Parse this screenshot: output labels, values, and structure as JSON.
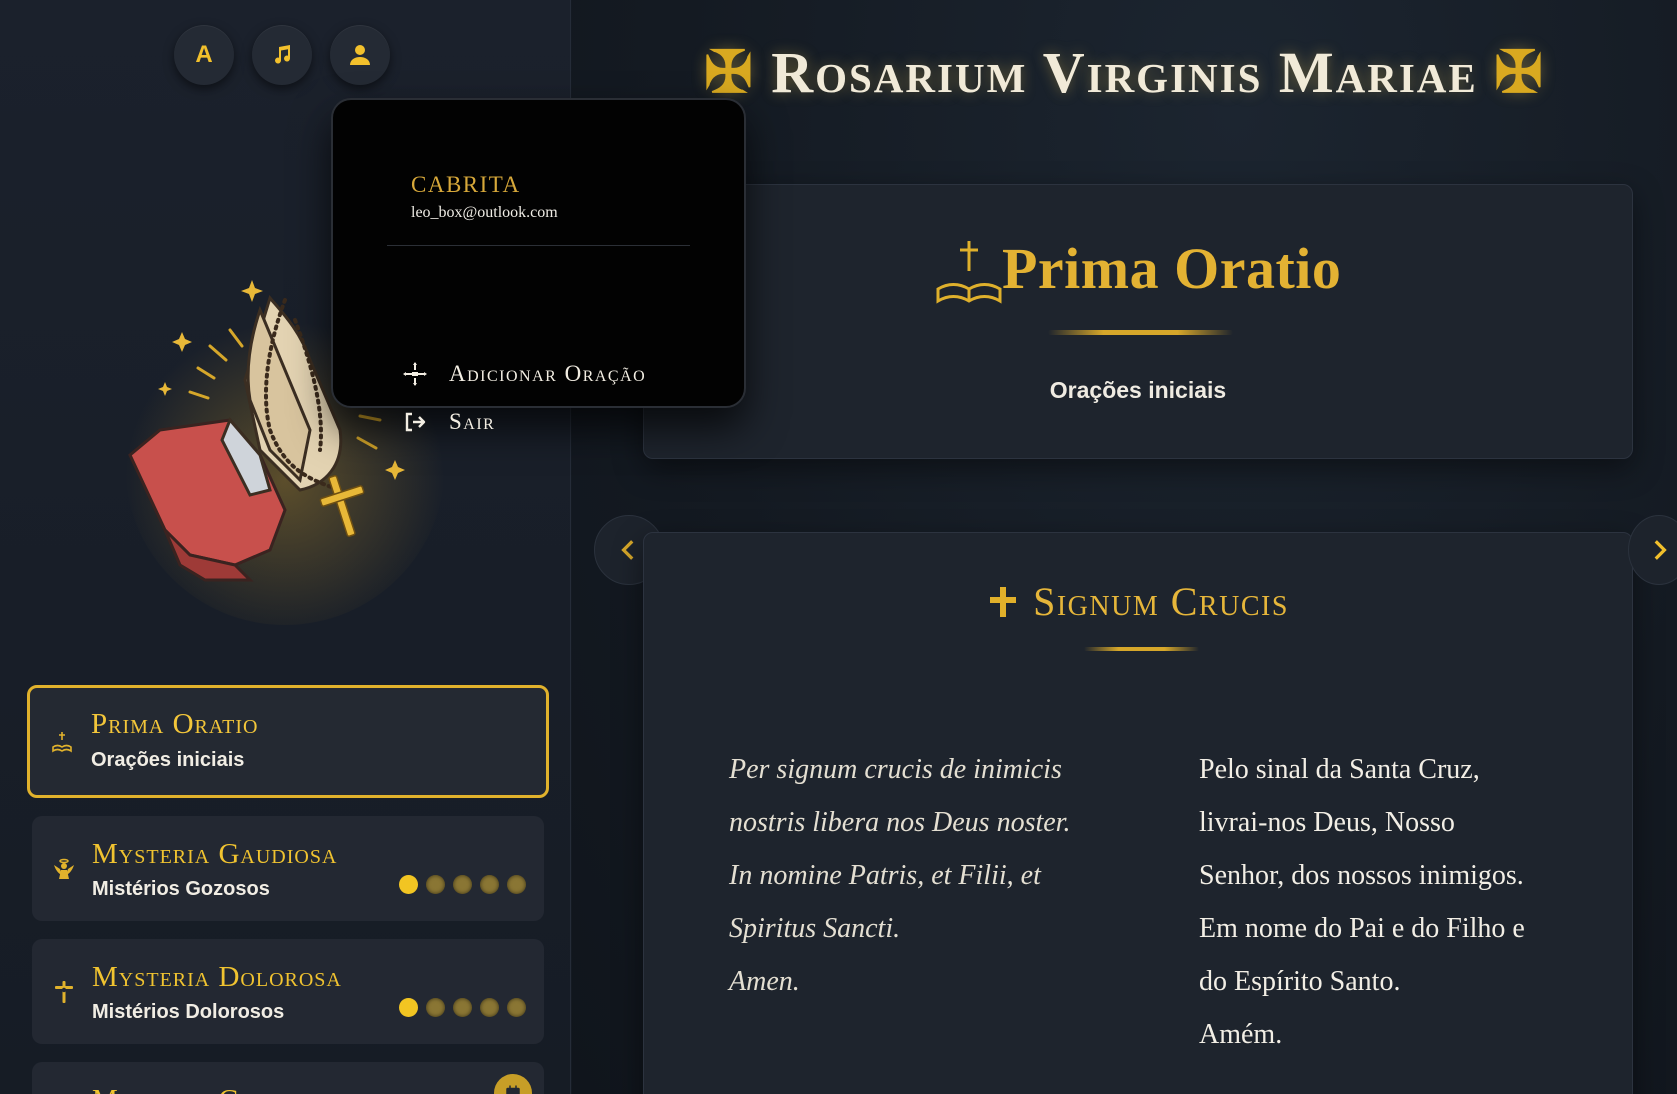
{
  "toolbar": {
    "font_btn": "A"
  },
  "user_menu": {
    "name": "CABRITA",
    "email": "leo_box@outlook.com",
    "items": [
      {
        "label": "Adicionar Oração",
        "icon": "cross-icon"
      },
      {
        "label": "Sair",
        "icon": "logout-icon"
      }
    ]
  },
  "page": {
    "title": "Rosarium Virginis Mariae",
    "title_cross": "✠"
  },
  "sidebar": {
    "sections": [
      {
        "title": "Prima Oratio",
        "subtitle": "Orações iniciais",
        "icon": "bible-cross-icon",
        "active": true
      },
      {
        "title": "Mysteria Gaudiosa",
        "subtitle": "Mistérios Gozosos",
        "icon": "angel-icon",
        "progress": {
          "done": 1,
          "total": 5
        }
      },
      {
        "title": "Mysteria Dolorosa",
        "subtitle": "Mistérios Dolorosos",
        "icon": "crucifix-icon",
        "progress": {
          "done": 1,
          "total": 5
        }
      },
      {
        "title": "Mysteria Gloriosa",
        "icon": "calendar-icon"
      }
    ]
  },
  "header_card": {
    "title": "Prima Oratio",
    "subtitle": "Orações iniciais"
  },
  "prayer": {
    "title": "Signum Crucis",
    "latin": [
      "Per signum crucis de inimicis",
      "nostris libera nos Deus noster.",
      "In nomine Patris, et Filii, et",
      "Spiritus Sancti.",
      "Amen."
    ],
    "portuguese": [
      "Pelo sinal da Santa Cruz,",
      "livrai-nos Deus, Nosso",
      "Senhor, dos nossos inimigos.",
      "Em nome do Pai e do Filho e",
      "do Espírito Santo.",
      "Amém."
    ]
  },
  "colors": {
    "gold": "#e1b22c",
    "background": "#141a22",
    "card": "#1e242d"
  }
}
